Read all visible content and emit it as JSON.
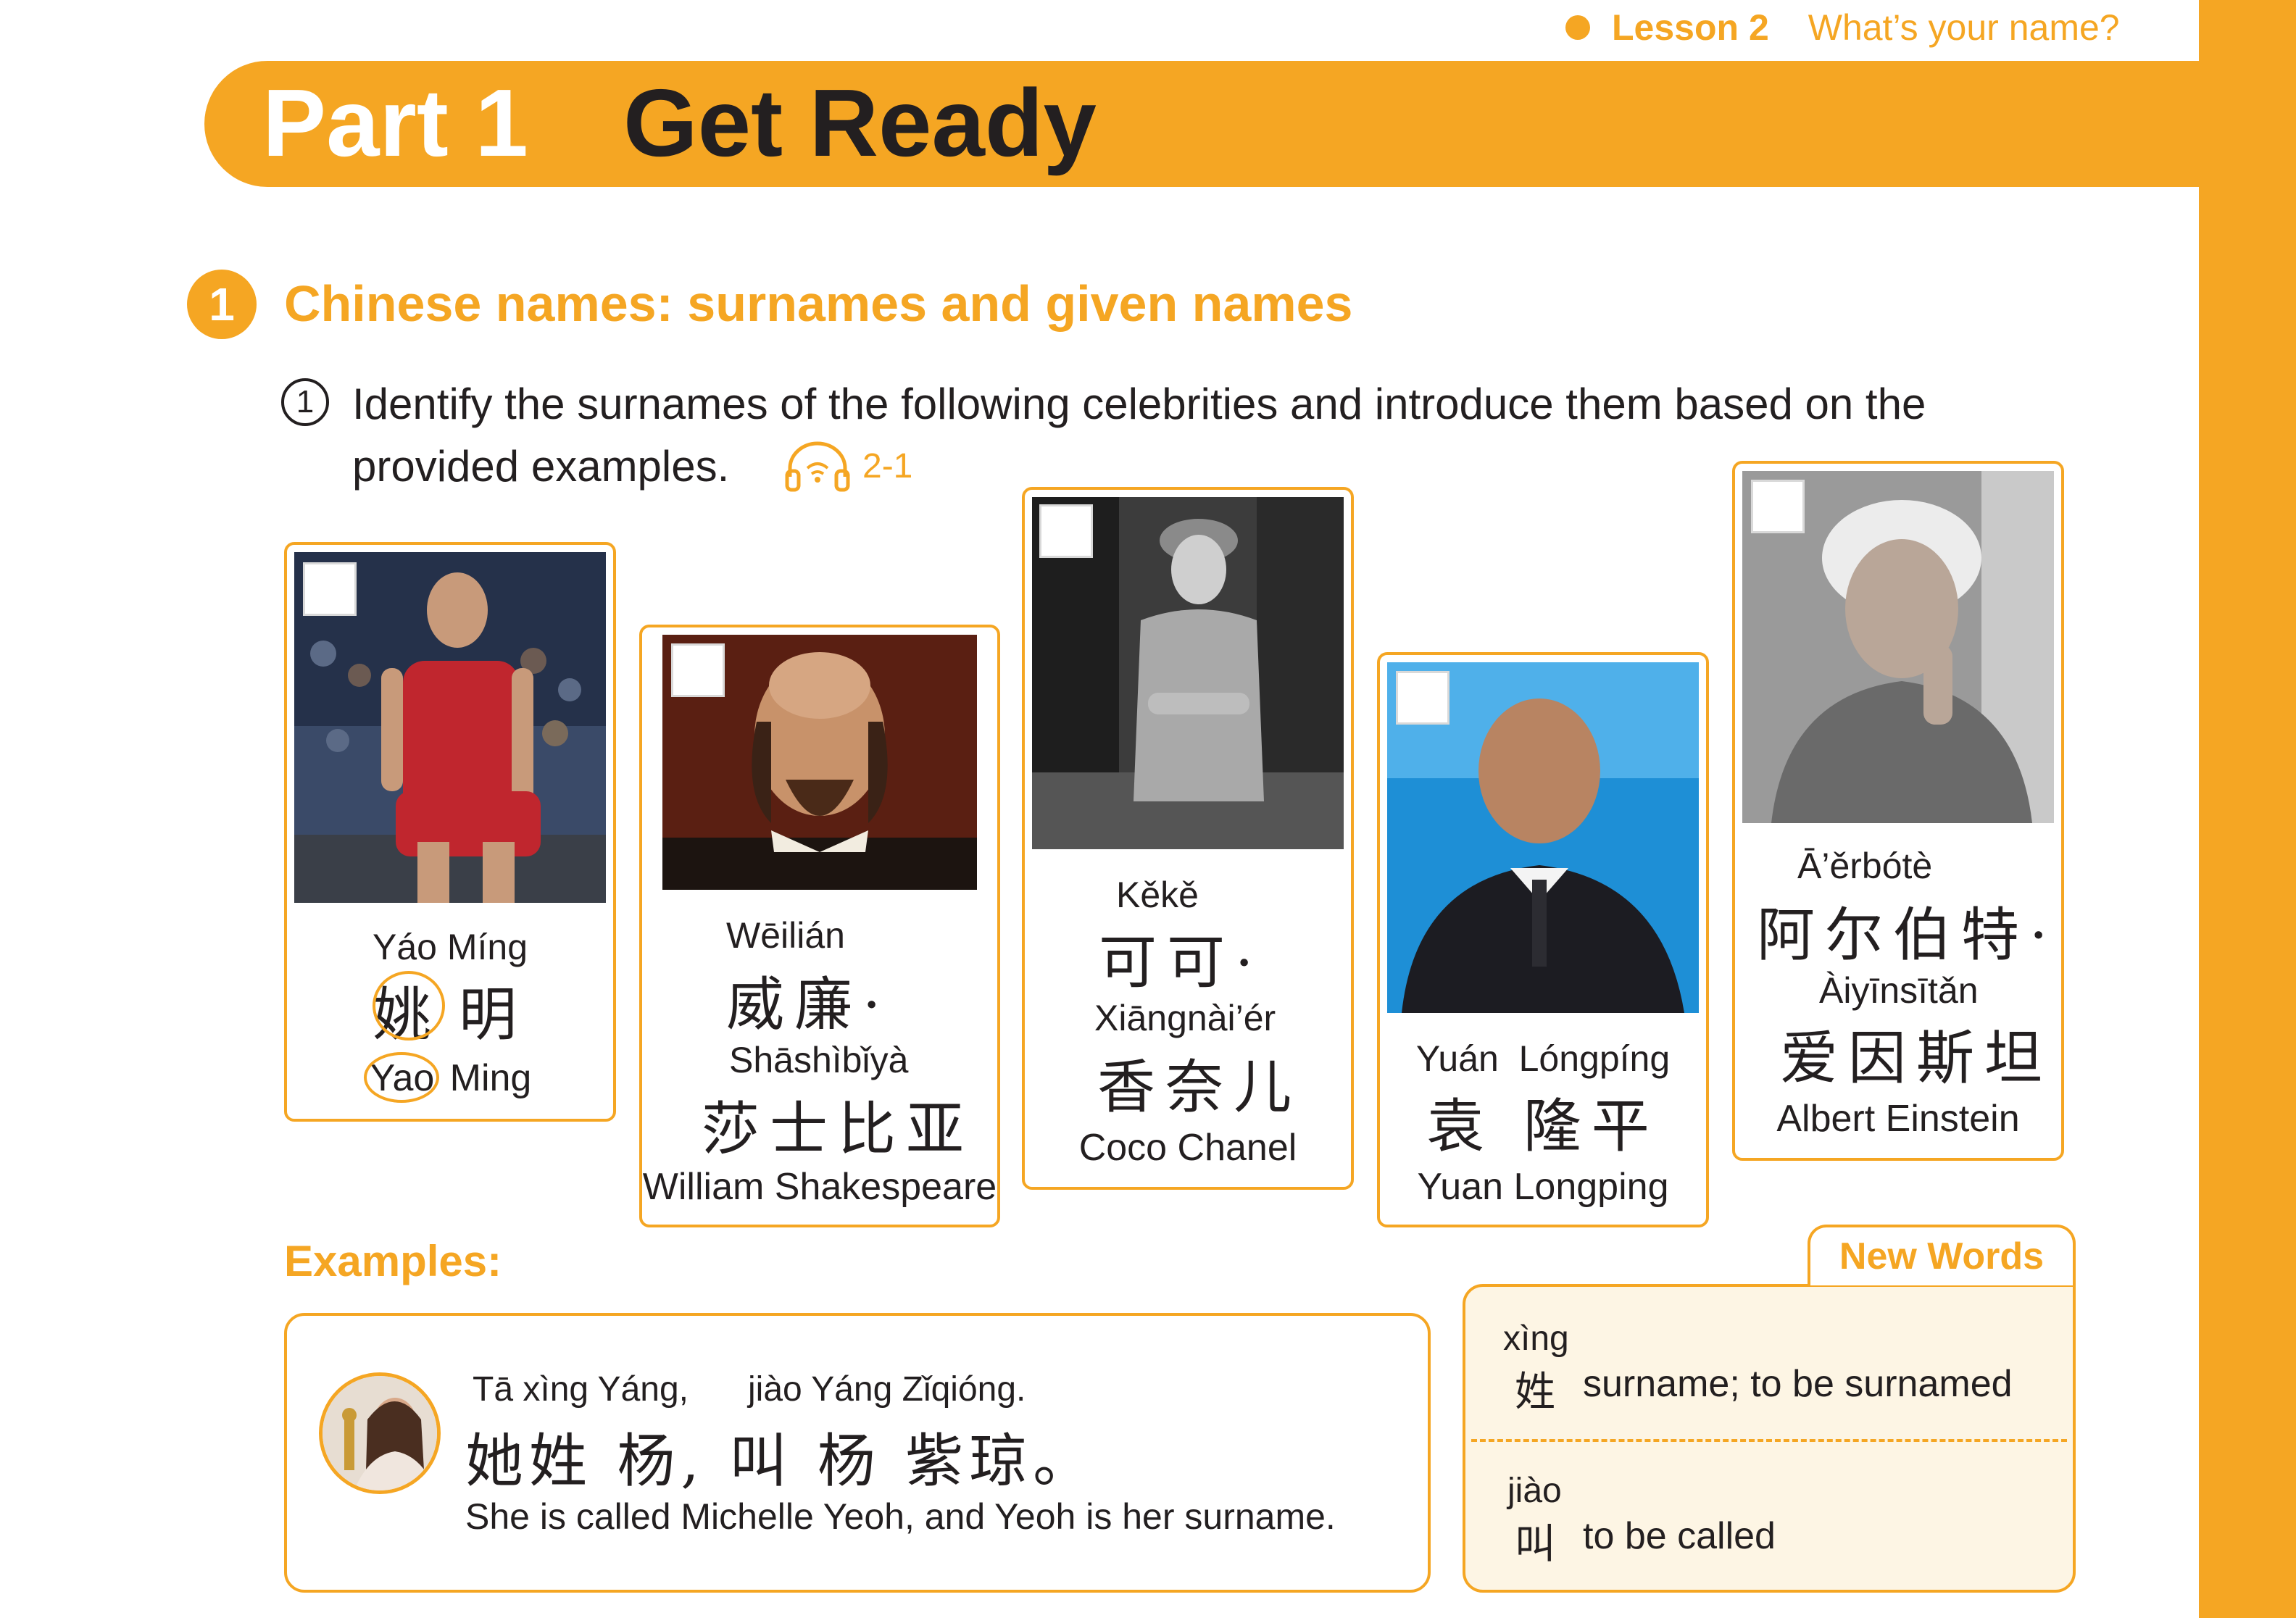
{
  "header": {
    "lesson_number": "Lesson 2",
    "lesson_title": "What’s your name?"
  },
  "banner": {
    "part_label": "Part 1",
    "part_title": "Get Ready"
  },
  "section": {
    "number": "1",
    "title": "Chinese names: surnames and given names"
  },
  "instruction": {
    "number": "1",
    "line1": "Identify the surnames of the following celebrities and introduce them based on the",
    "line2": "provided examples.",
    "audio_icon": "headphones-icon",
    "audio_label": "2-1"
  },
  "celebrities": [
    {
      "pinyin": "Yáo Míng",
      "hanzi_surname": "姚",
      "hanzi_given": "明",
      "english_surname": "Yao",
      "english_given": "Ming"
    },
    {
      "pinyin_1": "Wēilián",
      "hanzi_1": "威廉·",
      "pinyin_2": "Shāshìbǐyà",
      "hanzi_2": "莎士比亚",
      "english": "William Shakespeare"
    },
    {
      "pinyin_1": "Kěkě",
      "hanzi_1": "可可·",
      "pinyin_2": "Xiāngnài’ér",
      "hanzi_2": "香奈儿",
      "english": "Coco Chanel"
    },
    {
      "pinyin": "Yuán  Lóngpíng",
      "hanzi": "袁 隆平",
      "english": "Yuan Longping"
    },
    {
      "pinyin_1": "Ā’ěrbótè",
      "hanzi_1": "阿尔伯特·",
      "pinyin_2": "Àiyīnsītǎn",
      "hanzi_2": "爱因斯坦",
      "english": "Albert Einstein"
    }
  ],
  "examples": {
    "title": "Examples:",
    "pinyin_a": "Tā xìng Yáng,",
    "pinyin_b": "jiào Yáng Zǐqióng.",
    "hanzi": "她姓 杨, 叫 杨 紫琼。",
    "english": "She is called Michelle Yeoh, and Yeoh is her surname."
  },
  "new_words": {
    "title": "New Words",
    "items": [
      {
        "pinyin": "xìng",
        "hanzi": "姓",
        "meaning": "surname; to be surnamed"
      },
      {
        "pinyin": "jiào",
        "hanzi": "叫",
        "meaning": "to be called"
      }
    ]
  },
  "colors": {
    "accent": "#f5a623",
    "text": "#231f20",
    "new_words_bg": "#fdf5e4"
  }
}
